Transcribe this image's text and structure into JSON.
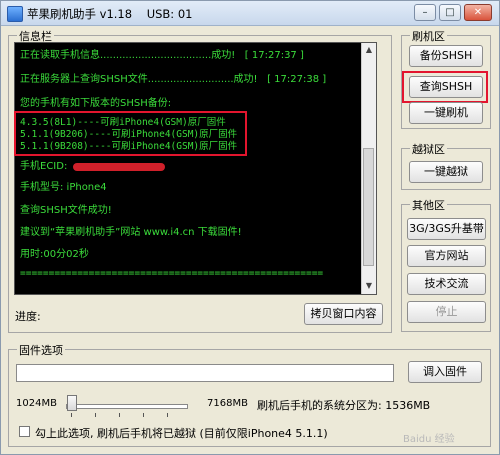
{
  "window": {
    "title": "苹果刷机助手 v1.18    USB: 01",
    "minimize": "–",
    "maximize": "□",
    "close": "✕"
  },
  "info_panel": {
    "label": "信息栏",
    "lines": [
      "正在读取手机信息...................................成功!   [ 17:27:37 ]",
      "正在服务器上查询SHSH文件...........................成功!   [ 17:27:38 ]",
      "您的手机有如下版本的SHSH备份:",
      "4.3.5(8L1)----可刷iPhone4(GSM)原厂固件",
      "5.1.1(9B206)----可刷iPhone4(GSM)原厂固件",
      "5.1.1(9B208)----可刷iPhone4(GSM)原厂固件",
      "手机ECID:",
      "手机型号: iPhone4",
      "查询SHSH文件成功!",
      "建议到“苹果刷机助手”网站 www.i4.cn 下载固件!",
      "用时:00分02秒",
      "====================================================="
    ],
    "progress_label": "进度:",
    "copy_button": "拷贝窗口内容"
  },
  "flash_group": {
    "label": "刷机区",
    "backup_shsh": "备份SHSH",
    "query_shsh": "查询SHSH",
    "one_click_flash": "一键刷机"
  },
  "jailbreak_group": {
    "label": "越狱区",
    "one_click_jailbreak": "一键越狱"
  },
  "other_group": {
    "label": "其他区",
    "baseband": "3G/3GS升基带",
    "official_site": "官方网站",
    "tech_exchange": "技术交流",
    "stop": "停止"
  },
  "firmware": {
    "label": "固件选项",
    "load_button": "调入固件",
    "min_size": "1024MB",
    "max_size": "7168MB",
    "partition_text": "刷机后手机的系统分区为: 1536MB",
    "jailbreak_option": "勾上此选项, 刷机后手机将已越狱 (目前仅限iPhone4 5.1.1)"
  },
  "watermark": "Baidu 经验",
  "colors": {
    "console_text": "#3bdc3b",
    "highlight": "#e3152e"
  }
}
